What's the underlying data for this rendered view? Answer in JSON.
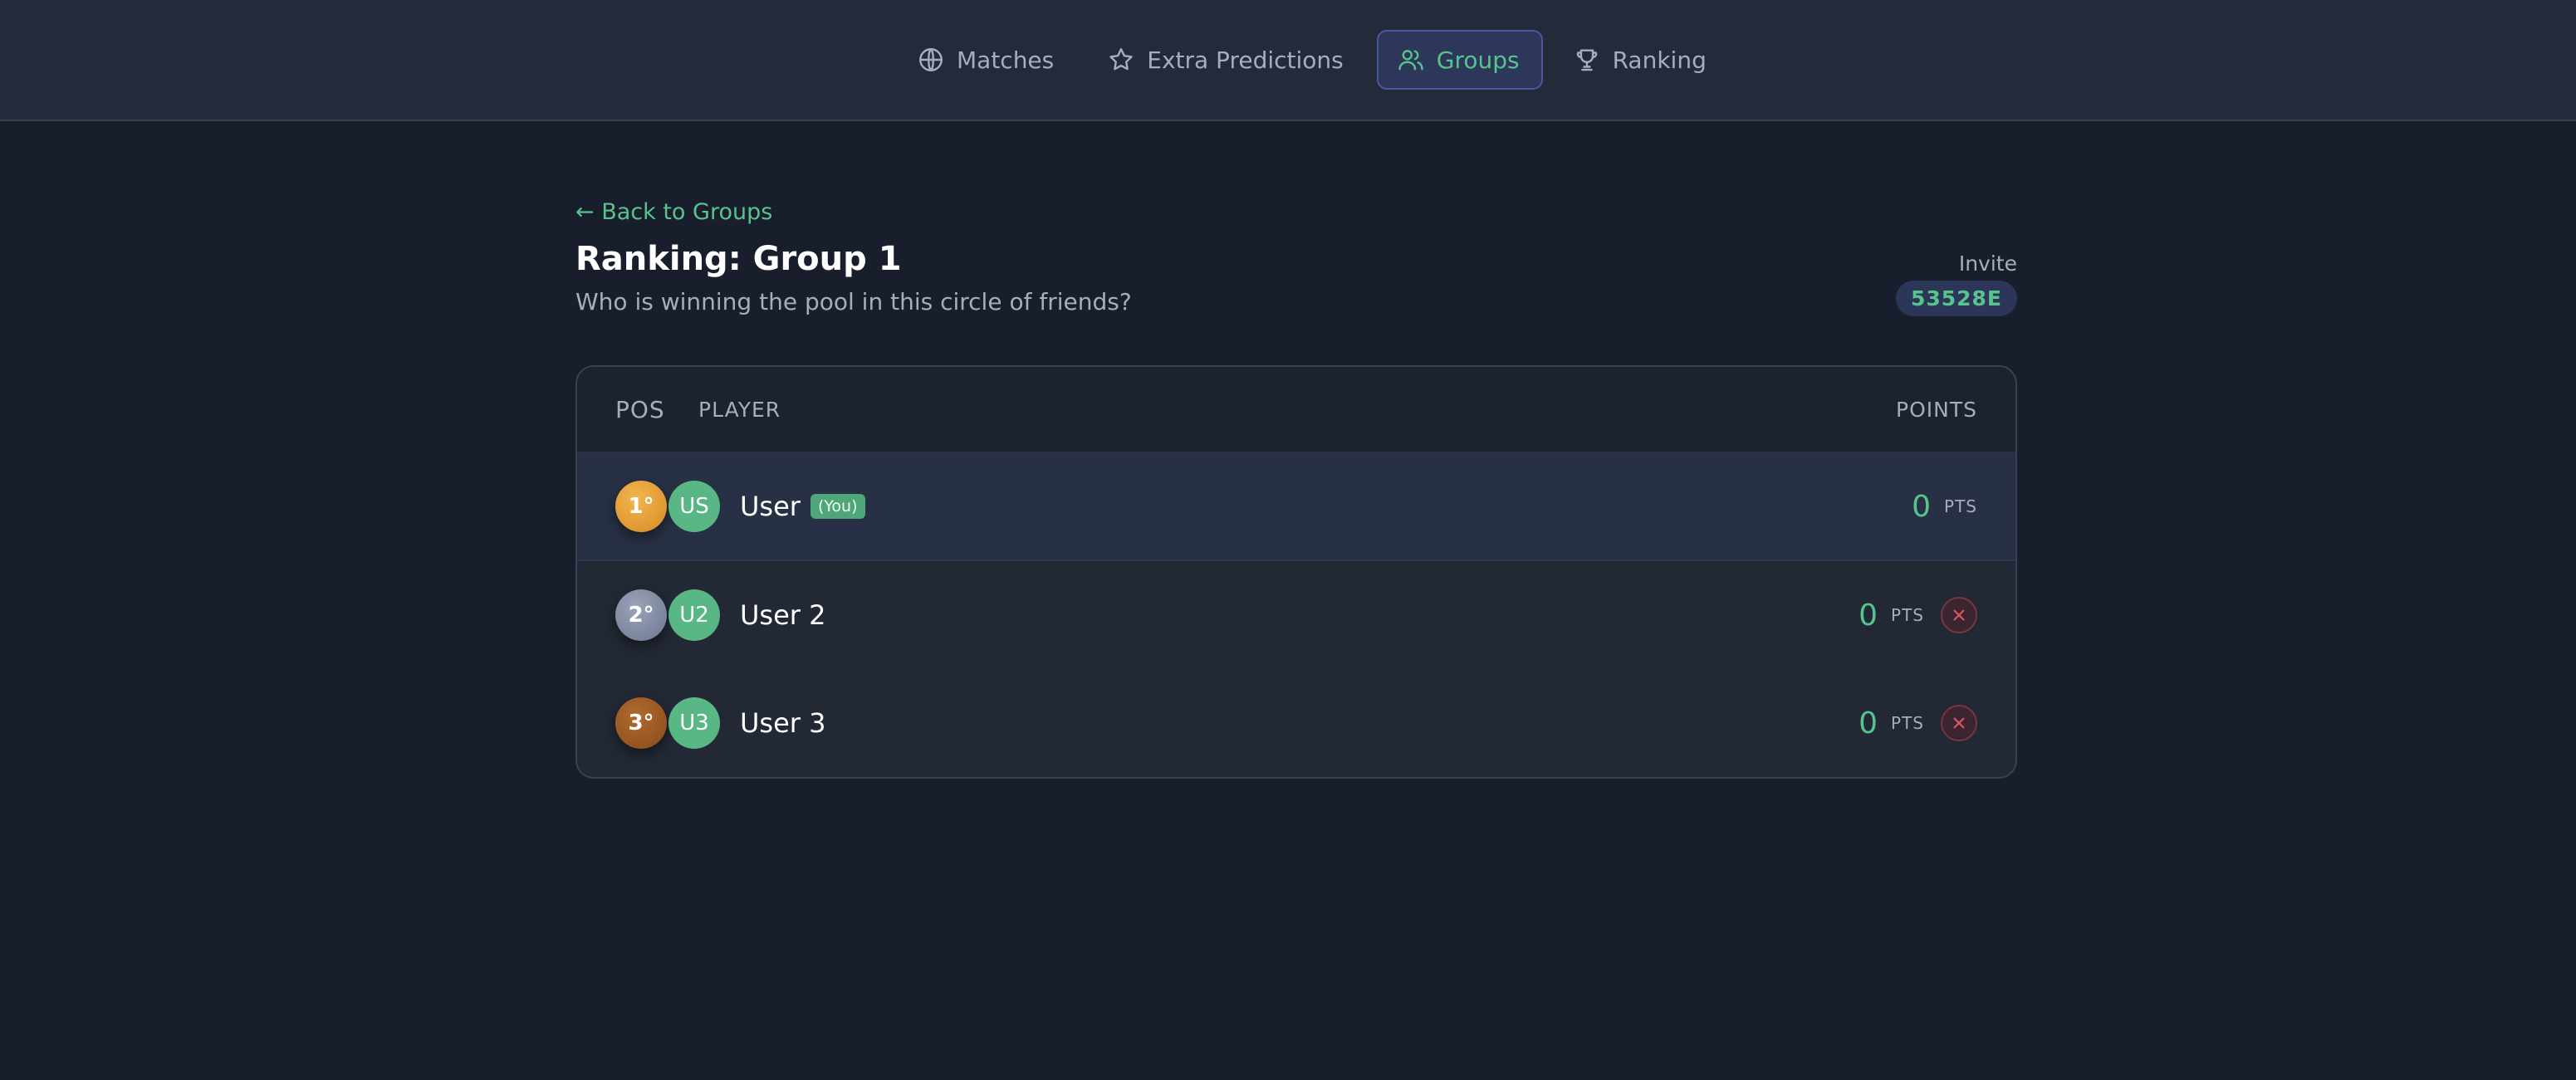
{
  "nav": {
    "items": [
      {
        "label": "Matches",
        "icon": "globe-icon",
        "active": false
      },
      {
        "label": "Extra Predictions",
        "icon": "star-icon",
        "active": false
      },
      {
        "label": "Groups",
        "icon": "users-icon",
        "active": true
      },
      {
        "label": "Ranking",
        "icon": "trophy-icon",
        "active": false
      }
    ]
  },
  "page": {
    "back_label": "← Back to Groups",
    "title": "Ranking: Group 1",
    "subtitle": "Who is winning the pool in this circle of friends?",
    "invite_label": "Invite",
    "invite_code": "53528E"
  },
  "table": {
    "headers": {
      "pos": "POS",
      "player": "PLAYER",
      "points": "POINTS"
    },
    "rows": [
      {
        "position": "1°",
        "initials": "US",
        "name": "User",
        "badge": "(You)",
        "points": "0",
        "unit": "PTS",
        "medal": "gold"
      },
      {
        "position": "2°",
        "initials": "U2",
        "name": "User 2",
        "points": "0",
        "unit": "PTS",
        "medal": "silver"
      },
      {
        "position": "3°",
        "initials": "U3",
        "name": "User 3",
        "points": "0",
        "unit": "PTS",
        "medal": "bronze"
      }
    ]
  },
  "colors": {
    "accent": "#58c38d",
    "background": "#181e2c",
    "danger": "#e0565f"
  }
}
